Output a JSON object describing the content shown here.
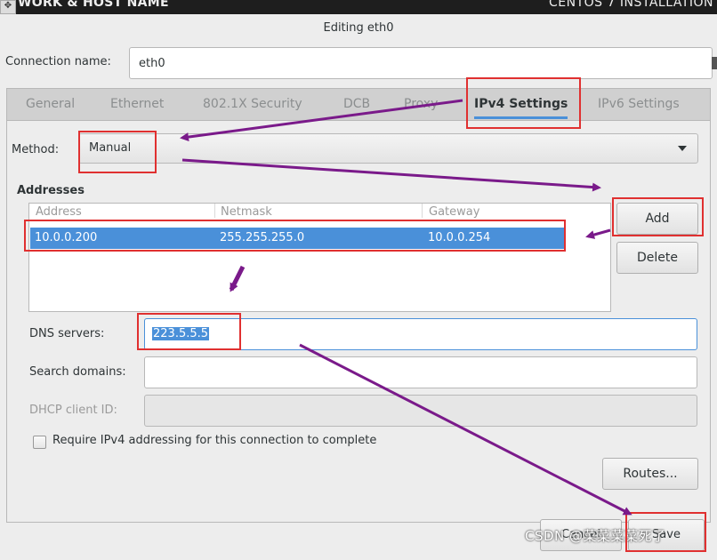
{
  "window": {
    "left_title": "WORK & HOST NAME",
    "right_title": "CENTOS 7 INSTALLATION",
    "dialog_title": "Editing eth0"
  },
  "connection": {
    "label": "Connection name:",
    "value": "eth0"
  },
  "tabs": [
    {
      "label": "General",
      "active": false
    },
    {
      "label": "Ethernet",
      "active": false
    },
    {
      "label": "802.1X Security",
      "active": false
    },
    {
      "label": "DCB",
      "active": false
    },
    {
      "label": "Proxy",
      "active": false
    },
    {
      "label": "IPv4 Settings",
      "active": true
    },
    {
      "label": "IPv6 Settings",
      "active": false
    }
  ],
  "method": {
    "label": "Method:",
    "value": "Manual"
  },
  "addresses": {
    "label": "Addresses",
    "columns": [
      "Address",
      "Netmask",
      "Gateway"
    ],
    "rows": [
      {
        "address": "10.0.0.200",
        "netmask": "255.255.255.0",
        "gateway": "10.0.0.254"
      }
    ],
    "add_label": "Add",
    "delete_label": "Delete"
  },
  "dns": {
    "label": "DNS servers:",
    "value": "223.5.5.5"
  },
  "search": {
    "label": "Search domains:",
    "value": ""
  },
  "dhcp": {
    "label": "DHCP client ID:",
    "value": ""
  },
  "require_ipv4": {
    "label": "Require IPv4 addressing for this connection to complete",
    "checked": false
  },
  "routes_label": "Routes...",
  "footer": {
    "cancel_label": "Cancel",
    "save_label": "Save"
  },
  "watermark": "CSDN @菜菜菜菜死了",
  "colors": {
    "selection": "#4a90d9",
    "annotation_box": "#e03030",
    "annotation_arrow": "#7a1a8a"
  }
}
